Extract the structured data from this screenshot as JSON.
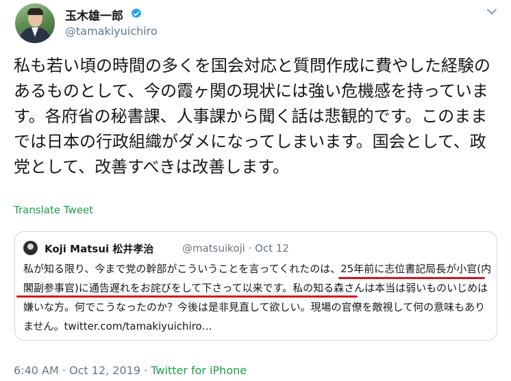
{
  "author": {
    "display_name": "玉木雄一郎",
    "handle": "@tamakiyuichiro",
    "verified": true
  },
  "tweet": {
    "text": "私も若い頃の時間の多くを国会対応と質問作成に費やした経験のあるものとして、今の霞ヶ関の現状には強い危機感を持っています。各府省の秘書課、人事課から聞く話は悲観的です。このままでは日本の行政組織がダメになってしまいます。国会として、政党として、改善すべきは改善します。",
    "translate_label": "Translate Tweet"
  },
  "quoted_tweet": {
    "name": "Koji Matsui 松井孝治",
    "handle_date": "@matsuikoji · Oct 12",
    "text": "私が知る限り、今まで党の幹部がこういうことを言ってくれたのは、25年前に志位書記局長が小官(内閣副参事官)に通告遅れをお詫びをして下さって以来です。私の知る森さんは本当は弱いものいじめは嫌いな方。何でこうなったのか？今後は是非見直して欲しい。現場の官僚を敵視して何の意味もありません。twitter.com/tamakiyuichiro…"
  },
  "meta": {
    "time_date": "6:40 AM · Oct 12, 2019 · ",
    "source": "Twitter for iPhone"
  },
  "colors": {
    "link_green": "#1b9e4e",
    "verified_blue": "#1da1f2",
    "underline_red": "#d4121b",
    "muted": "#657786"
  },
  "icons": {
    "verified": "verified-badge-icon",
    "menu": "chevron-down-icon"
  }
}
